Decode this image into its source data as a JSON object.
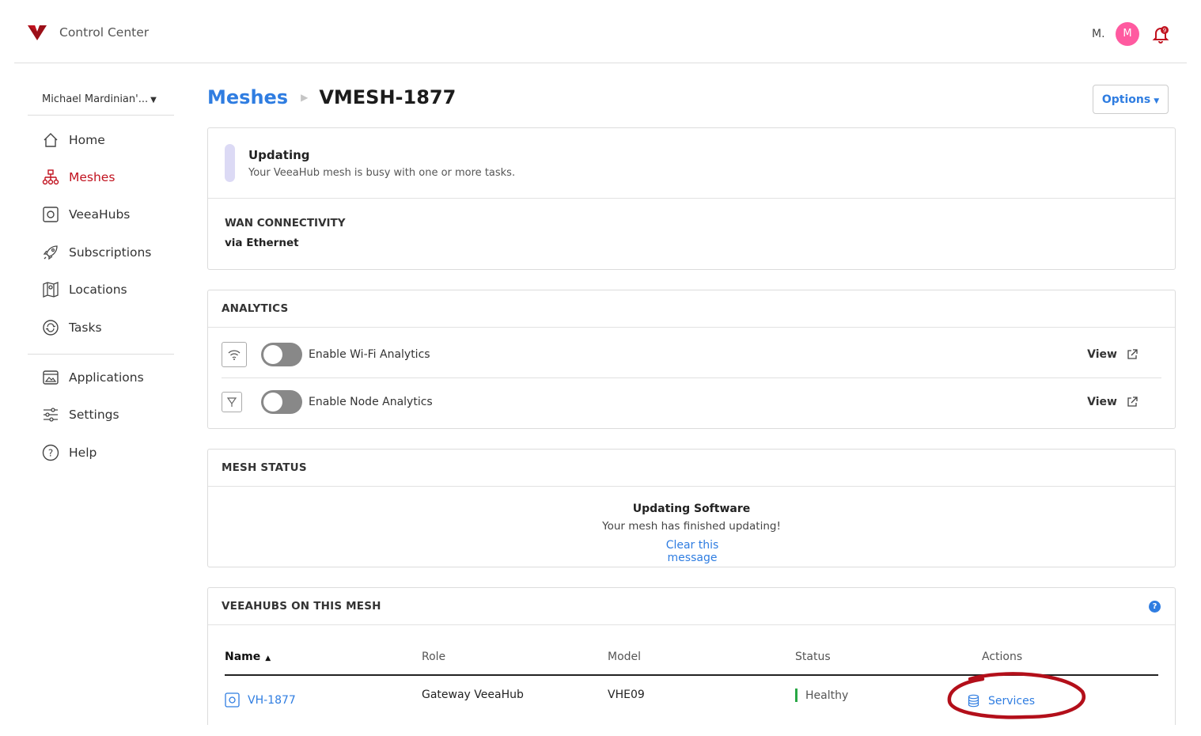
{
  "app": {
    "title": "Control Center",
    "user_initials_short": "M.",
    "avatar_initial": "M",
    "brand_color": "#c1121f",
    "accent_color": "#2f7de1"
  },
  "sidebar": {
    "org": "Michael Mardinian'...",
    "items": [
      {
        "label": "Home",
        "icon": "home-icon"
      },
      {
        "label": "Meshes",
        "icon": "mesh-network-icon",
        "active": true
      },
      {
        "label": "VeeaHubs",
        "icon": "veeahub-icon"
      },
      {
        "label": "Subscriptions",
        "icon": "rocket-icon"
      },
      {
        "label": "Locations",
        "icon": "map-pin-icon"
      },
      {
        "label": "Tasks",
        "icon": "tasks-cycle-icon"
      },
      {
        "label": "Applications",
        "icon": "applications-icon"
      },
      {
        "label": "Settings",
        "icon": "sliders-icon"
      },
      {
        "label": "Help",
        "icon": "help-circle-icon"
      }
    ]
  },
  "header": {
    "breadcrumb_parent": "Meshes",
    "breadcrumb_current": "VMESH-1877",
    "options_label": "Options"
  },
  "status_card": {
    "title": "Updating",
    "subtitle": "Your VeeaHub mesh is busy with one or more tasks.",
    "wan_label": "WAN CONNECTIVITY",
    "wan_value": "via Ethernet"
  },
  "analytics": {
    "header": "ANALYTICS",
    "rows": [
      {
        "label": "Enable Wi-Fi Analytics",
        "view": "View",
        "enabled": false,
        "icon": "wifi-icon"
      },
      {
        "label": "Enable Node Analytics",
        "view": "View",
        "enabled": false,
        "icon": "node-icon"
      }
    ]
  },
  "mesh_status": {
    "header": "MESH STATUS",
    "title": "Updating Software",
    "message": "Your mesh has finished updating!",
    "link": "Clear this message"
  },
  "veeahubs": {
    "header": "VEEAHUBS ON THIS MESH",
    "columns": [
      "Name",
      "Role",
      "Model",
      "Status",
      "Actions"
    ],
    "rows": [
      {
        "name": "VH-1877",
        "role": "Gateway VeeaHub",
        "model": "VHE09",
        "status": "Healthy",
        "action": "Services"
      }
    ]
  }
}
